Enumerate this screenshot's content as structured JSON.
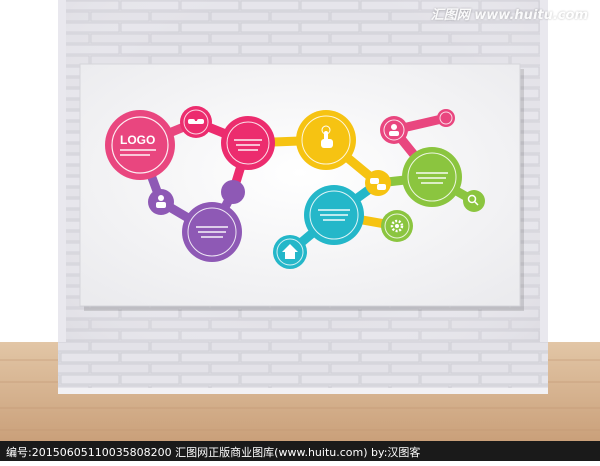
{
  "watermark": {
    "site": "汇图网 www.huitu.com"
  },
  "board": {
    "logo_text": "LOGO",
    "colors": {
      "pink": "#e9467f",
      "magenta": "#ec2c6e",
      "yellow": "#f6c312",
      "teal": "#24b7c9",
      "green": "#8bc53f",
      "purple": "#8e59b5",
      "wall": "#dcdbe1",
      "floor": "#d9b896"
    },
    "icons": [
      "handshake-icon",
      "hand-pointer-icon",
      "user-badge-icon",
      "chat-bubbles-icon",
      "search-icon",
      "gear-icon",
      "home-icon",
      "person-icon"
    ]
  },
  "footer": {
    "text": "编号:20150605110035808200   汇图网正版商业图库(www.huitu.com)  by:汉图客"
  }
}
